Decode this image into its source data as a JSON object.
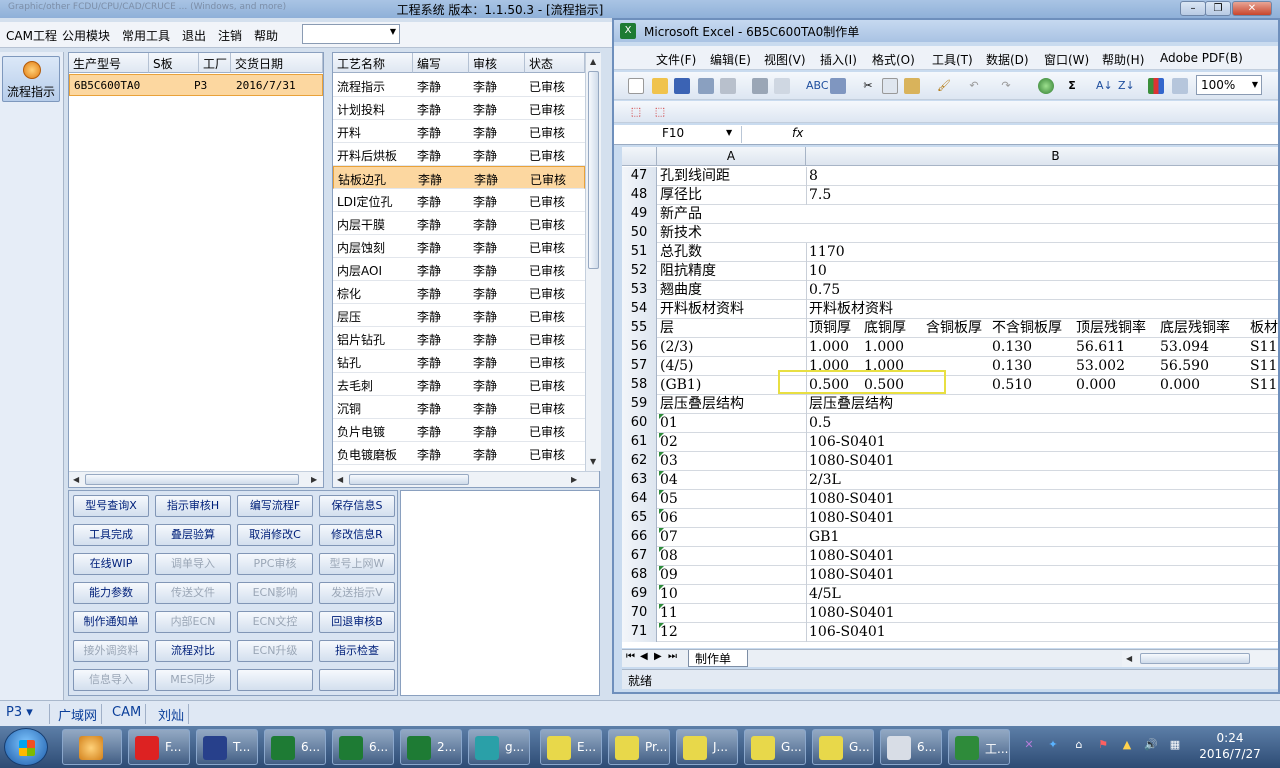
{
  "app": {
    "title": "工程系统   版本：1.1.50.3 - [流程指示]",
    "ghost_text": "Graphic/other FCDU/CPU/CAD/CRUCE ... (Windows, and more)"
  },
  "menubar": {
    "items": [
      "CAM工程",
      "公用模块",
      "常用工具",
      "退出",
      "注销",
      "帮助"
    ],
    "combo_value": ""
  },
  "left_tool": {
    "label": "流程指示"
  },
  "product_table": {
    "headers": [
      "生产型号",
      "S板",
      "工厂",
      "交货日期"
    ],
    "rows": [
      {
        "model": "6B5C600TA0",
        "s": "",
        "factory": "P3",
        "date": "2016/7/31"
      }
    ]
  },
  "process_table": {
    "headers": [
      "工艺名称",
      "编写",
      "审核",
      "状态"
    ],
    "rows": [
      [
        "流程指示",
        "李静",
        "李静",
        "已审核"
      ],
      [
        "计划投料",
        "李静",
        "李静",
        "已审核"
      ],
      [
        "开料",
        "李静",
        "李静",
        "已审核"
      ],
      [
        "开料后烘板",
        "李静",
        "李静",
        "已审核"
      ],
      [
        "钻板边孔",
        "李静",
        "李静",
        "已审核"
      ],
      [
        "LDI定位孔",
        "李静",
        "李静",
        "已审核"
      ],
      [
        "内层干膜",
        "李静",
        "李静",
        "已审核"
      ],
      [
        "内层蚀刻",
        "李静",
        "李静",
        "已审核"
      ],
      [
        "内层AOI",
        "李静",
        "李静",
        "已审核"
      ],
      [
        "棕化",
        "李静",
        "李静",
        "已审核"
      ],
      [
        "层压",
        "李静",
        "李静",
        "已审核"
      ],
      [
        "铝片钻孔",
        "李静",
        "李静",
        "已审核"
      ],
      [
        "钻孔",
        "李静",
        "李静",
        "已审核"
      ],
      [
        "去毛刺",
        "李静",
        "李静",
        "已审核"
      ],
      [
        "沉铜",
        "李静",
        "李静",
        "已审核"
      ],
      [
        "负片电镀",
        "李静",
        "李静",
        "已审核"
      ],
      [
        "负电镀磨板",
        "李静",
        "李静",
        "已审核"
      ]
    ],
    "selected_index": 4
  },
  "function_buttons": [
    [
      "型号查询X",
      "指示审核H",
      "编写流程F",
      "保存信息S"
    ],
    [
      "工具完成",
      "叠层验算",
      "取消修改C",
      "修改信息R"
    ],
    [
      "在线WIP",
      "调单导入",
      "PPC审核",
      "型号上网W"
    ],
    [
      "能力参数",
      "传送文件",
      "ECN影响",
      "发送指示V"
    ],
    [
      "制作通知单",
      "内部ECN",
      "ECN文控",
      "回退审核B"
    ],
    [
      "接外调资料",
      "流程对比",
      "ECN升级",
      "指示检查"
    ],
    [
      "信息导入",
      "MES同步",
      "",
      ""
    ]
  ],
  "main_status": {
    "factory": "P3",
    "net": "广域网",
    "module": "CAM",
    "user": "刘灿"
  },
  "excel": {
    "title": "Microsoft Excel - 6B5C600TA0制作单",
    "menu": [
      "文件(F)",
      "编辑(E)",
      "视图(V)",
      "插入(I)",
      "格式(O)",
      "工具(T)",
      "数据(D)",
      "窗口(W)",
      "帮助(H)",
      "Adobe PDF(B)"
    ],
    "zoom": "100%",
    "name_box": "F10",
    "fx": "fx",
    "col_a": "A",
    "col_b": "B",
    "rows": [
      {
        "n": "47",
        "a": "孔到线间距",
        "b": "8"
      },
      {
        "n": "48",
        "a": "厚径比",
        "b": "7.5"
      },
      {
        "n": "49",
        "a": "新产品",
        "b": ""
      },
      {
        "n": "50",
        "a": "新技术",
        "b": ""
      },
      {
        "n": "51",
        "a": "总孔数",
        "b": "1170"
      },
      {
        "n": "52",
        "a": "阻抗精度",
        "b": "10"
      },
      {
        "n": "53",
        "a": "翘曲度",
        "b": "0.75"
      },
      {
        "n": "54",
        "a": "开料板材资料",
        "b": "开料板材资料"
      },
      {
        "n": "55",
        "a": "层",
        "b": "顶铜厚",
        "c": "底铜厚",
        "d": "含铜板厚",
        "e": "不含铜板厚",
        "f": "顶层残铜率",
        "g": "底层残铜率",
        "h": "板材"
      },
      {
        "n": "56",
        "a": "(2/3)",
        "b": "1.000",
        "c": "1.000",
        "d": "",
        "e": "0.130",
        "f": "56.611",
        "g": "53.094",
        "h": "S11"
      },
      {
        "n": "57",
        "a": "(4/5)",
        "b": "1.000",
        "c": "1.000",
        "d": "",
        "e": "0.130",
        "f": "53.002",
        "g": "56.590",
        "h": "S11"
      },
      {
        "n": "58",
        "a": "(GB1)",
        "b": "0.500",
        "c": "0.500",
        "d": "",
        "e": "0.510",
        "f": "0.000",
        "g": "0.000",
        "h": "S11"
      },
      {
        "n": "59",
        "a": "层压叠层结构",
        "b": "层压叠层结构"
      },
      {
        "n": "60",
        "a": "01",
        "b": "0.5"
      },
      {
        "n": "61",
        "a": "02",
        "b": "106-S0401"
      },
      {
        "n": "62",
        "a": "03",
        "b": "1080-S0401"
      },
      {
        "n": "63",
        "a": "04",
        "b": "2/3L"
      },
      {
        "n": "64",
        "a": "05",
        "b": "1080-S0401"
      },
      {
        "n": "65",
        "a": "06",
        "b": "1080-S0401"
      },
      {
        "n": "66",
        "a": "07",
        "b": "GB1"
      },
      {
        "n": "67",
        "a": "08",
        "b": "1080-S0401"
      },
      {
        "n": "68",
        "a": "09",
        "b": "1080-S0401"
      },
      {
        "n": "69",
        "a": "10",
        "b": "4/5L"
      },
      {
        "n": "70",
        "a": "11",
        "b": "1080-S0401"
      },
      {
        "n": "71",
        "a": "12",
        "b": "106-S0401"
      }
    ],
    "sheet_tab": "制作单",
    "status": "就绪"
  },
  "taskbar": {
    "items": [
      "F...",
      "T...",
      "6...",
      "6...",
      "2...",
      "g...",
      "E...",
      "Pr...",
      "J...",
      "G...",
      "G...",
      "6...",
      "工..."
    ],
    "time": "0:24",
    "date": "2016/7/27"
  }
}
